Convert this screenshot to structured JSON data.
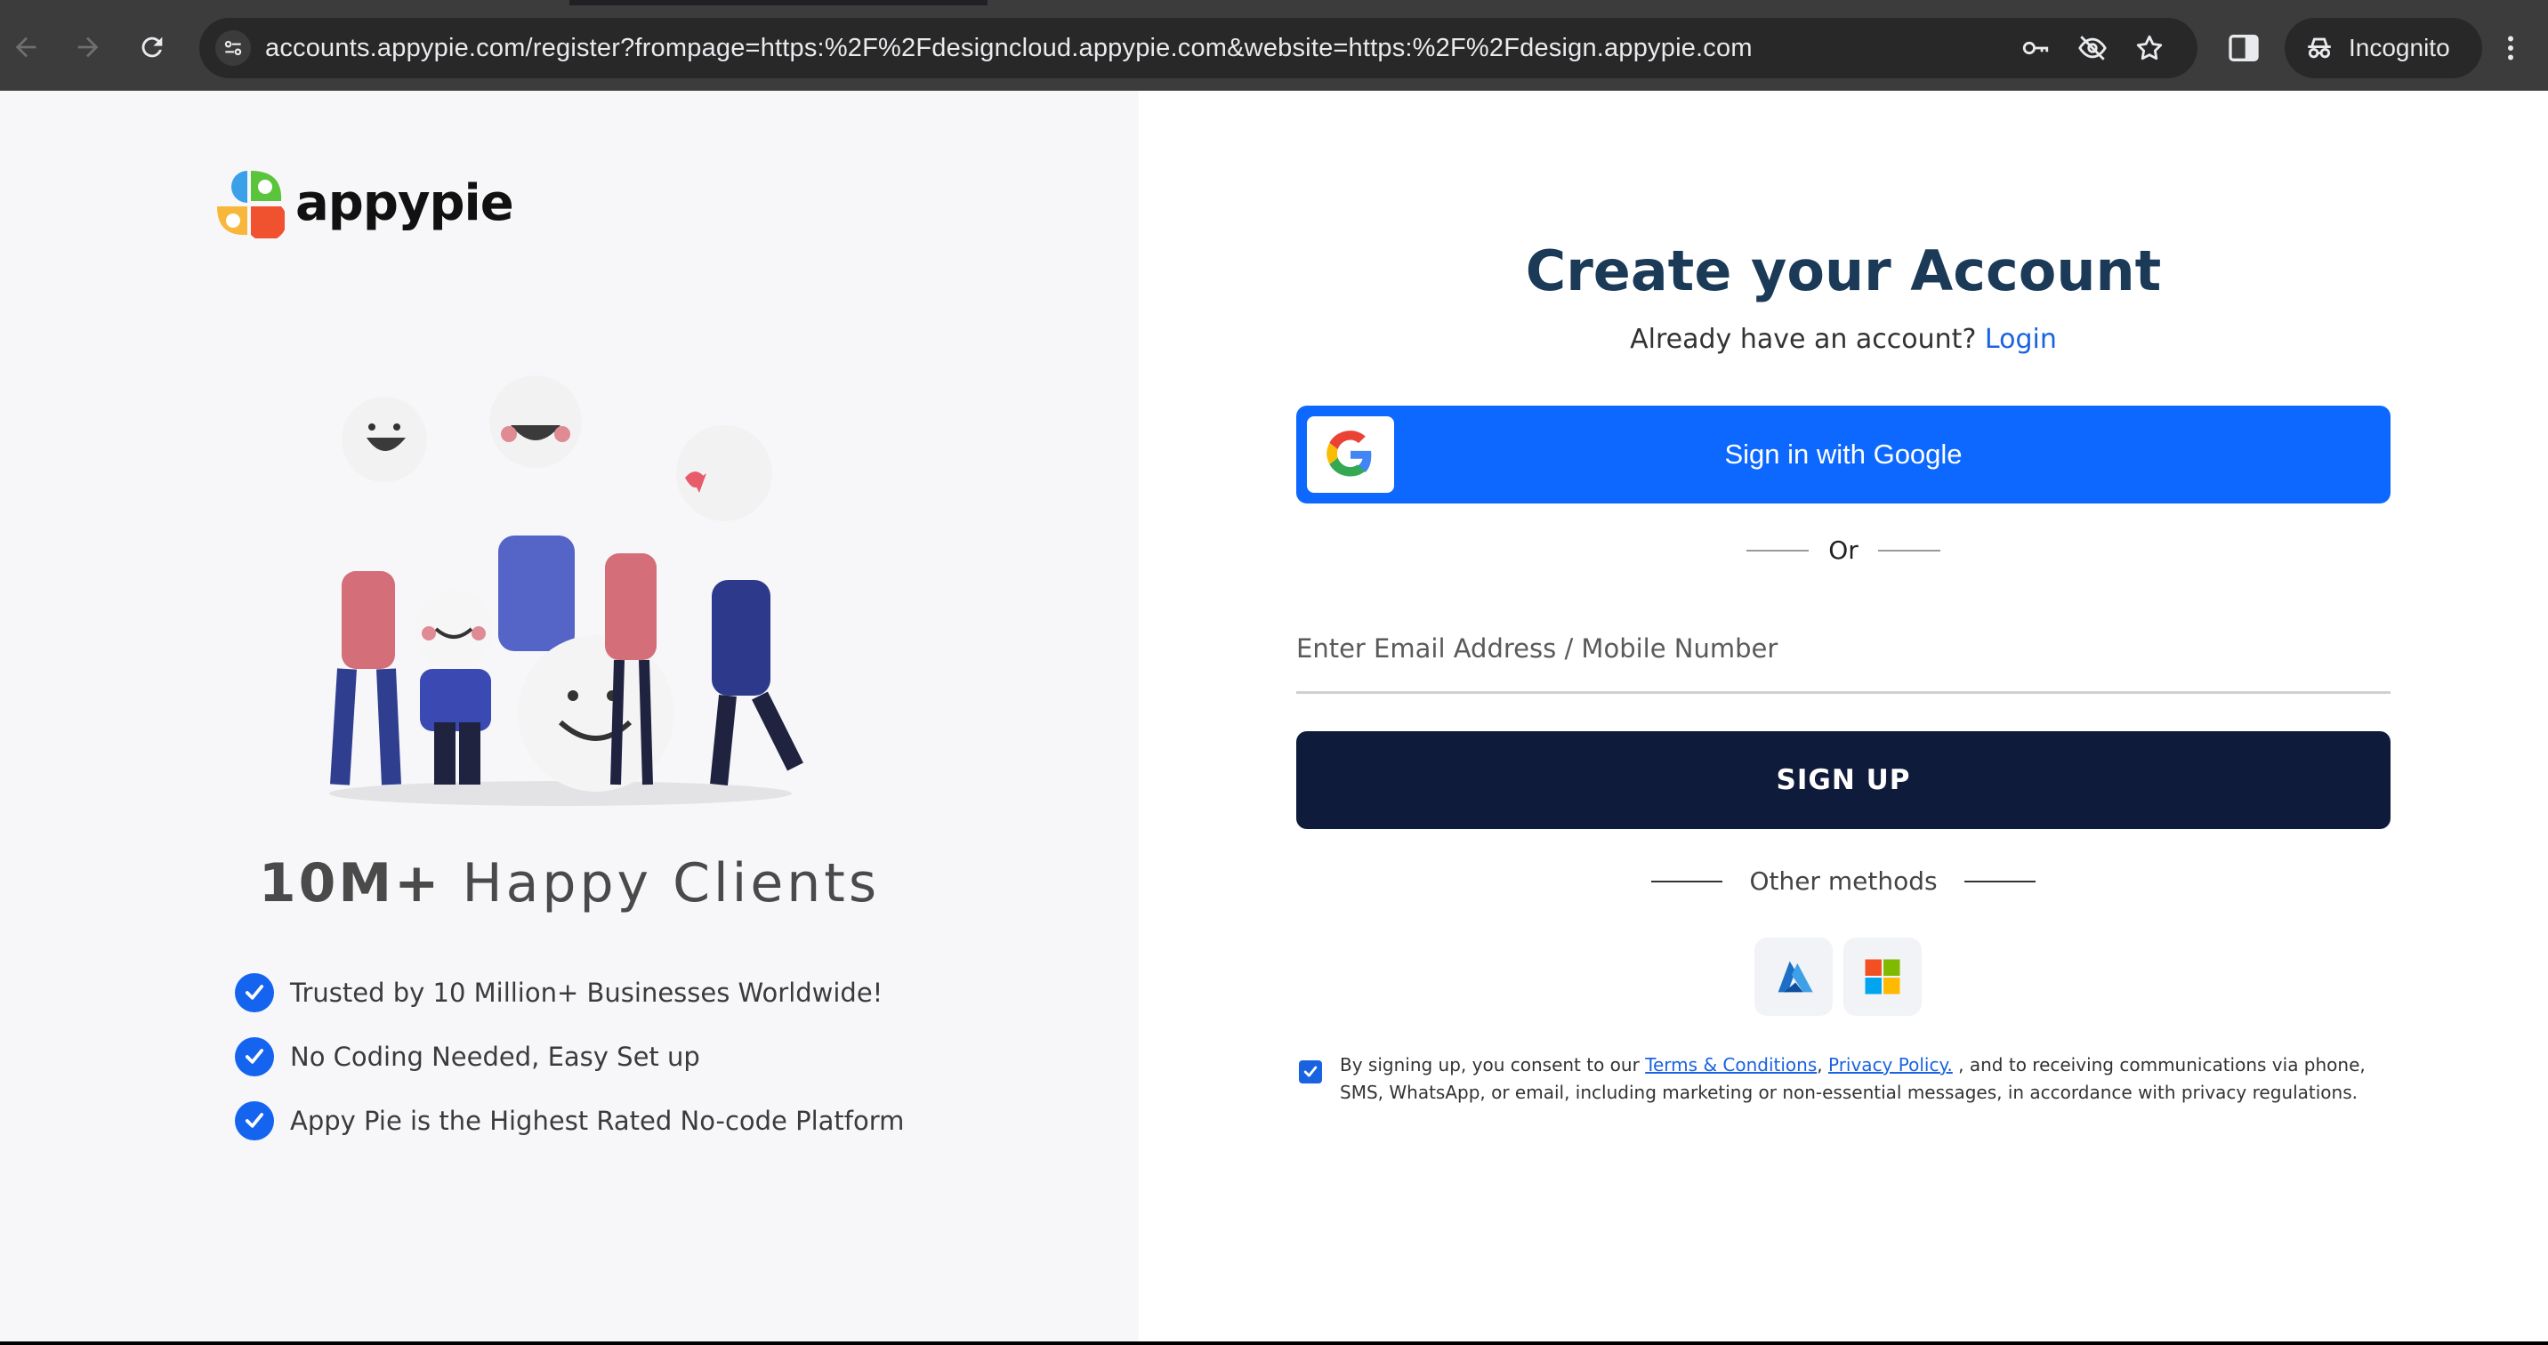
{
  "browser": {
    "url": "accounts.appypie.com/register?frompage=https:%2F%2Fdesigncloud.appypie.com&website=https:%2F%2Fdesign.appypie.com",
    "incognito_label": "Incognito",
    "icons": [
      "back-icon",
      "forward-icon",
      "reload-icon",
      "site-info-icon",
      "key-icon",
      "eye-off-icon",
      "star-icon",
      "side-panel-icon",
      "incognito-icon",
      "kebab-menu-icon"
    ]
  },
  "brand": {
    "name": "appypie"
  },
  "left": {
    "headline_strong": "10M+",
    "headline_rest": " Happy Clients",
    "features": [
      "Trusted by 10 Million+ Businesses Worldwide!",
      "No Coding Needed, Easy Set up",
      "Appy Pie is the Highest Rated No-code Platform"
    ]
  },
  "form": {
    "title": "Create your Account",
    "already_text": "Already have an account?",
    "login_link": "Login",
    "google_label": "Sign in with Google",
    "or_label": "Or",
    "email_placeholder": "Enter Email Address / Mobile Number",
    "signup_label": "SIGN UP",
    "other_methods_label": "Other methods",
    "consent": {
      "prefix": "By signing up, you consent to our ",
      "terms": "Terms & Conditions",
      "separator": ", ",
      "privacy": "Privacy Policy.",
      "suffix": " , and to receiving communications via phone, SMS, WhatsApp, or email, including marketing or non-essential messages, in accordance with privacy regulations.",
      "checked": true
    }
  },
  "colors": {
    "google_button": "#0d68ff",
    "signup_button": "#0f1b3a",
    "title": "#1b3a57",
    "link": "#1a63e0",
    "check": "#1564f0"
  }
}
